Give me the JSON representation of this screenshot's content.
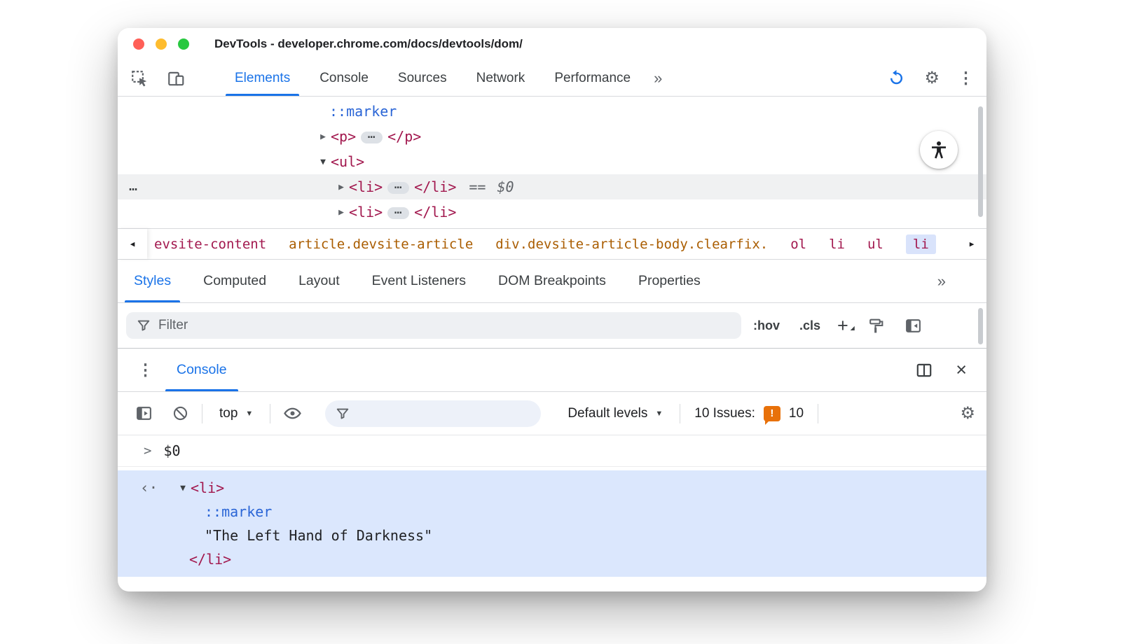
{
  "window": {
    "title": "DevTools - developer.chrome.com/docs/devtools/dom/"
  },
  "colors": {
    "accent_blue": "#1a73e8",
    "tag_color": "#a2184e",
    "class_color": "#aa5d00",
    "marker_blue": "#2a65d6",
    "issues_orange": "#e8710a",
    "selected_row_bg": "#f0f1f2",
    "selected_crumb_bg": "#d9e3fb",
    "result_bg": "#dbe7fd",
    "traffic_red": "#ff5f57",
    "traffic_yellow": "#febc2e",
    "traffic_green": "#28c840"
  },
  "icons": {
    "more_chevrons": "»",
    "gear": "⚙",
    "kebab": "⋮",
    "close": "×",
    "caret_down": "▼",
    "tri_collapsed": "▶",
    "tri_expanded": "▼",
    "crumb_left": "◀",
    "crumb_right": "▶",
    "ellipsis": "…",
    "overflow_ellipsis": "…",
    "returned_value": "‹·",
    "plus": "+",
    "plus_caret": "◢",
    "prompt_chevron": ">",
    "issues_glyph": "!"
  },
  "toolbar": {
    "selected_tab": "Elements",
    "tabs": [
      {
        "label": "Elements"
      },
      {
        "label": "Console"
      },
      {
        "label": "Sources"
      },
      {
        "label": "Network"
      },
      {
        "label": "Performance"
      }
    ]
  },
  "dom_tree": {
    "marker": "::marker",
    "p_open": "<p>",
    "p_close": "</p>",
    "ul_open": "<ul>",
    "li_open": "<li>",
    "li_close": "</li>",
    "equals": "==",
    "dollar_zero": "$0"
  },
  "breadcrumbs": {
    "items": [
      {
        "label": "evsite-content",
        "kind": "tag"
      },
      {
        "label": "article.devsite-article",
        "kind": "class"
      },
      {
        "label": "div.devsite-article-body.clearfix.",
        "kind": "class"
      },
      {
        "label": "ol",
        "kind": "tag"
      },
      {
        "label": "li",
        "kind": "tag"
      },
      {
        "label": "ul",
        "kind": "tag"
      },
      {
        "label": "li",
        "kind": "tag",
        "selected": true
      }
    ]
  },
  "styles_panel": {
    "selected_tab": "Styles",
    "tabs": [
      {
        "label": "Styles"
      },
      {
        "label": "Computed"
      },
      {
        "label": "Layout"
      },
      {
        "label": "Event Listeners"
      },
      {
        "label": "DOM Breakpoints"
      },
      {
        "label": "Properties"
      }
    ],
    "filter_placeholder": "Filter",
    "hov_label": ":hov",
    "cls_label": ".cls"
  },
  "console": {
    "tab_label": "Console",
    "context_selector": "top",
    "levels_selector": "Default levels",
    "issues_label": "10 Issues:",
    "issues_count": "10",
    "prompt_expression": "$0",
    "result": {
      "li_open": "<li>",
      "marker": "::marker",
      "text": "\"The Left Hand of Darkness\"",
      "li_close": "</li>"
    }
  }
}
